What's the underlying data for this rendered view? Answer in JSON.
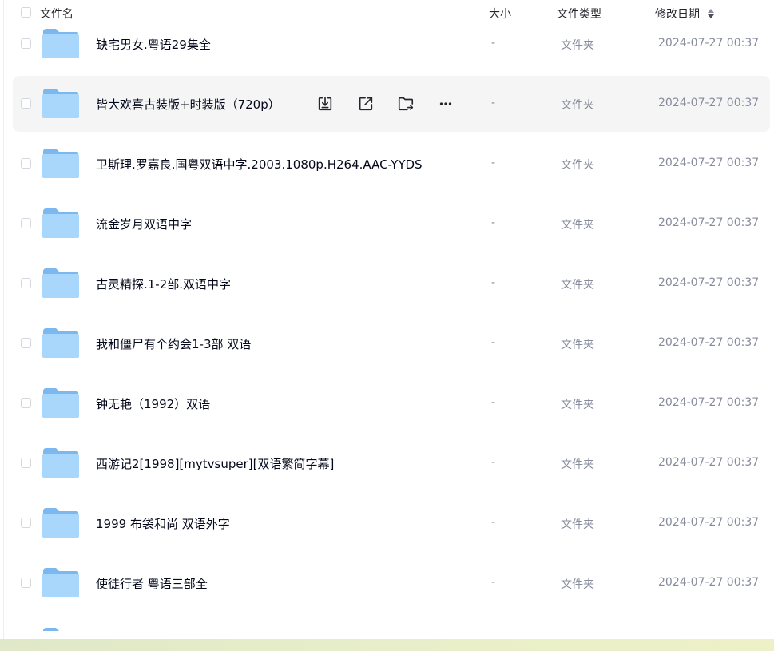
{
  "header": {
    "name_label": "文件名",
    "size_label": "大小",
    "type_label": "文件类型",
    "date_label": "修改日期"
  },
  "colors": {
    "folder_back": "#7ab8ef",
    "folder_front": "#a9d6fb",
    "hover_row": "#f5f5f6",
    "muted_text": "#878c9c"
  },
  "rows": [
    {
      "name": "缺宅男女.粤语29集全",
      "size": "-",
      "type": "文件夹",
      "date": "2024-07-27 00:37"
    },
    {
      "name": "皆大欢喜古装版+时装版（720p）",
      "size": "-",
      "type": "文件夹",
      "date": "2024-07-27 00:37"
    },
    {
      "name": "卫斯理.罗嘉良.国粤双语中字.2003.1080p.H264.AAC-YYDS",
      "size": "-",
      "type": "文件夹",
      "date": "2024-07-27 00:37"
    },
    {
      "name": "流金岁月双语中字",
      "size": "-",
      "type": "文件夹",
      "date": "2024-07-27 00:37"
    },
    {
      "name": "古灵精探.1-2部.双语中字",
      "size": "-",
      "type": "文件夹",
      "date": "2024-07-27 00:37"
    },
    {
      "name": "我和僵尸有个约会1-3部 双语",
      "size": "-",
      "type": "文件夹",
      "date": "2024-07-27 00:37"
    },
    {
      "name": "钟无艳（1992）双语",
      "size": "-",
      "type": "文件夹",
      "date": "2024-07-27 00:37"
    },
    {
      "name": "西游记2[1998][mytvsuper][双语繁简字幕]",
      "size": "-",
      "type": "文件夹",
      "date": "2024-07-27 00:37"
    },
    {
      "name": "1999 布袋和尚 双语外字",
      "size": "-",
      "type": "文件夹",
      "date": "2024-07-27 00:37"
    },
    {
      "name": "使徒行者 粤语三部全",
      "size": "-",
      "type": "文件夹",
      "date": "2024-07-27 00:37"
    }
  ],
  "row_actions": {
    "icons": [
      "download-icon",
      "share-icon",
      "move-icon",
      "more-icon"
    ]
  }
}
